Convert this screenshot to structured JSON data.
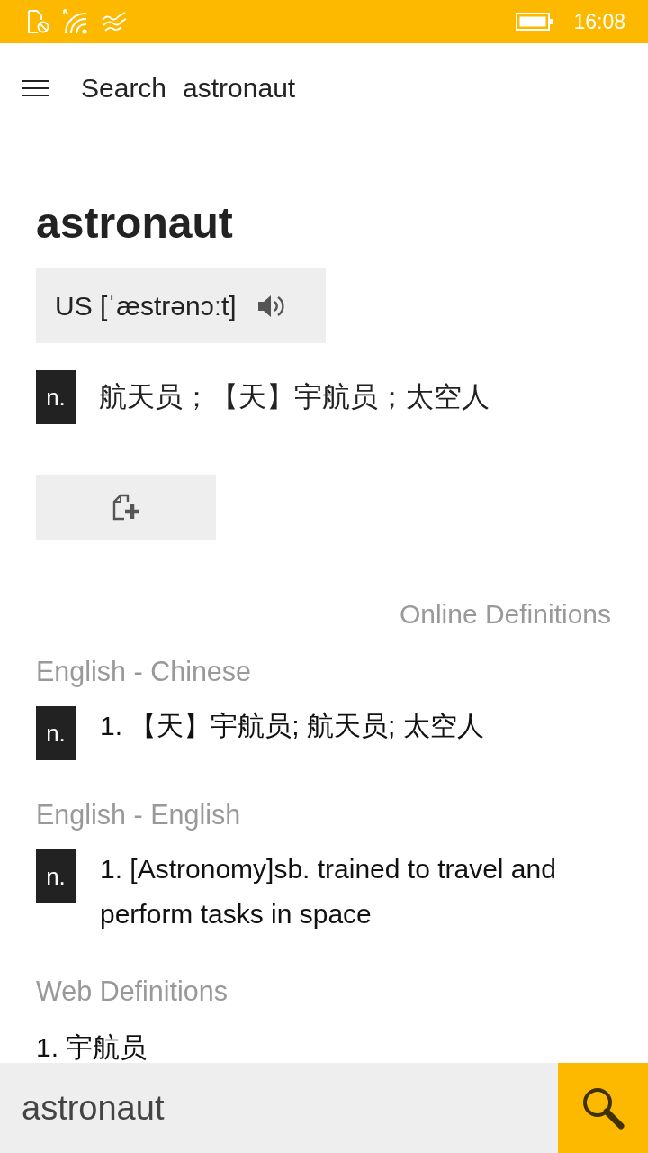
{
  "status_bar": {
    "time": "16:08"
  },
  "header": {
    "title": "Search",
    "query": "astronaut"
  },
  "entry": {
    "word": "astronaut",
    "pronunciations": [
      {
        "label": "US [ˈæstrənɔːt]"
      }
    ],
    "senses": [
      {
        "pos": "n.",
        "text": "航天员；【天】宇航员；太空人"
      }
    ]
  },
  "online": {
    "title": "Online Definitions",
    "sections": [
      {
        "title": "English - Chinese",
        "items": [
          {
            "pos": "n.",
            "text": "1. 【天】宇航员; 航天员; 太空人"
          }
        ]
      },
      {
        "title": "English - English",
        "items": [
          {
            "pos": "n.",
            "text": "1. [Astronomy]sb. trained to travel and perform tasks in space"
          }
        ]
      },
      {
        "title": "Web Definitions",
        "items": [
          {
            "text": "1. 宇航员"
          }
        ]
      }
    ]
  },
  "search_bar": {
    "value": "astronaut"
  }
}
